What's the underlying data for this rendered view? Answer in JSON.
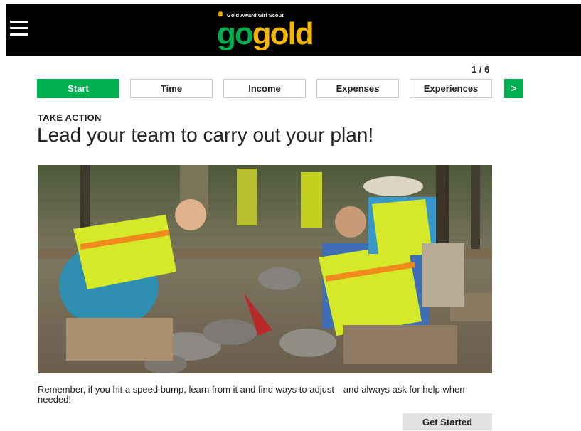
{
  "header": {
    "menu_icon": "hamburger-menu-icon",
    "logo": {
      "tagline": "Gold Award Girl Scout",
      "word_go": "go",
      "word_gold": "gold"
    }
  },
  "progress": {
    "label": "1 / 6",
    "current": 1,
    "total": 6
  },
  "tabs": [
    {
      "label": "Start",
      "active": true
    },
    {
      "label": "Time",
      "active": false
    },
    {
      "label": "Income",
      "active": false
    },
    {
      "label": "Expenses",
      "active": false
    },
    {
      "label": "Experiences",
      "active": false
    }
  ],
  "next_icon": ">",
  "section": {
    "eyebrow": "TAKE ACTION",
    "headline": "Lead your team to carry out your plan!"
  },
  "caption": "Remember, if you hit a speed bump, learn from it and find ways to adjust—and always ask for help when needed!",
  "cta": {
    "label": "Get Started"
  },
  "colors": {
    "accent": "#00b050",
    "gold": "#f5b800",
    "header_bg": "#000000"
  }
}
